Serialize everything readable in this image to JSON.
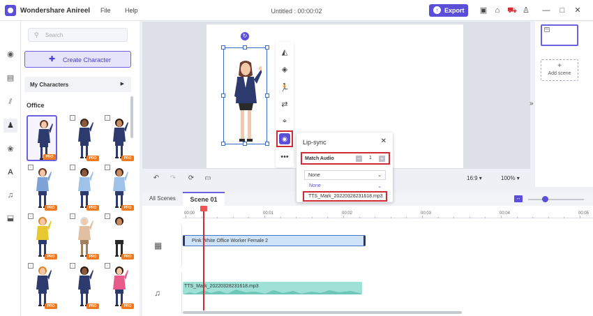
{
  "app": {
    "name": "Wondershare Anireel",
    "menu": [
      "File",
      "Help"
    ],
    "doc_title": "Untitled : 00:00:02",
    "export_label": "Export"
  },
  "titlebar_icons": [
    "save-icon",
    "home-icon",
    "cart-icon",
    "user-icon",
    "minimize-icon",
    "maximize-icon",
    "close-icon"
  ],
  "leftbar_icons": [
    "media-icon",
    "layout-icon",
    "transition-icon",
    "character-icon",
    "props-icon",
    "text-icon",
    "music-icon",
    "import-icon"
  ],
  "panel": {
    "search_placeholder": "Search",
    "create_label": "Create Character",
    "my_characters": "My Characters",
    "category": "Office",
    "pro_badge": "PRO"
  },
  "characters": [
    {
      "hair": "#6b3a2a",
      "top": "#2d3a6e",
      "bottom": "#2d3a6e",
      "skin": "#f2c9a8"
    },
    {
      "hair": "#3a2a20",
      "top": "#2d3a6e",
      "bottom": "#2d3a6e",
      "skin": "#8b5a3c"
    },
    {
      "hair": "#2a1a10",
      "top": "#2d3a6e",
      "bottom": "#2d3a6e",
      "skin": "#c68a5e"
    },
    {
      "hair": "#6b3a2a",
      "top": "#7da2d8",
      "bottom": "#2d3a6e",
      "skin": "#f2c9a8"
    },
    {
      "hair": "#2a1a10",
      "top": "#9fc3e8",
      "bottom": "#2d3a6e",
      "skin": "#8b5a3c"
    },
    {
      "hair": "#3a2a20",
      "top": "#9fc3e8",
      "bottom": "#2d3a6e",
      "skin": "#c68a5e"
    },
    {
      "hair": "#d88a2a",
      "top": "#e8c830",
      "bottom": "#2d3a6e",
      "skin": "#f2c9a8"
    },
    {
      "hair": "#ddd",
      "top": "#e0c0a0",
      "bottom": "#a08060",
      "skin": "#f2c9a8"
    },
    {
      "hair": "#2a1a10",
      "top": "#ffffff",
      "bottom": "#2a2a2a",
      "skin": "#c68a5e"
    },
    {
      "hair": "#d88a2a",
      "top": "#2d3a6e",
      "bottom": "#2d3a6e",
      "skin": "#f2c9a8"
    },
    {
      "hair": "#2a1a10",
      "top": "#2d3a6e",
      "bottom": "#2d3a6e",
      "skin": "#8b5a3c"
    },
    {
      "hair": "#2a1a10",
      "top": "#e85a8a",
      "bottom": "#2d3a6e",
      "skin": "#f2c9a8"
    }
  ],
  "preview": {
    "ratio": "16:9",
    "zoom": "100%"
  },
  "scene_panel": {
    "thumb_number": "01",
    "add_scene": "Add scene"
  },
  "lipsync": {
    "title": "Lip-sync",
    "match_audio": "Match Audio",
    "count": "1",
    "selected": "None",
    "options": [
      "None",
      "TTS_Mark_20220328231618.mp3"
    ]
  },
  "timeline": {
    "tab_all": "All Scenes",
    "tab_scene": "Scene 01",
    "ruler": [
      "00:00",
      "00:01",
      "00:02",
      "00:03",
      "00:04",
      "00:05"
    ],
    "video_clip": "Pink White Office Worker Female 2",
    "audio_clip": "TTS_Mark_20220328231618.mp3"
  },
  "colors": {
    "accent": "#5b4ed8",
    "highlight": "#d02b33",
    "pro": "#f0781e"
  }
}
